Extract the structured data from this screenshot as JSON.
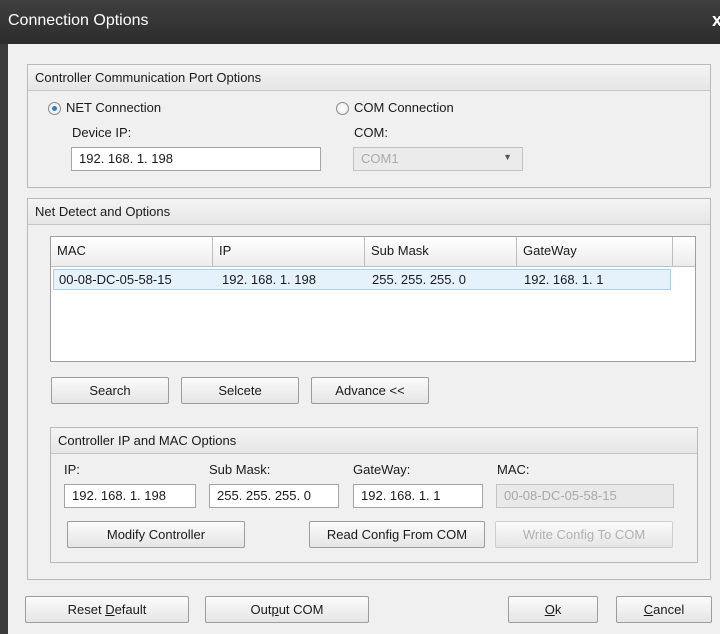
{
  "window": {
    "title": "Connection Options",
    "close_glyph": "x"
  },
  "port_options": {
    "header": "Controller Communication Port Options",
    "net": {
      "label": "NET Connection",
      "selected": true,
      "device_ip_label": "Device IP:",
      "device_ip_value": "192. 168. 1. 198"
    },
    "com": {
      "label": "COM Connection",
      "selected": false,
      "com_label": "COM:",
      "com_value": "COM1"
    }
  },
  "net_detect": {
    "header": "Net Detect and Options",
    "columns": [
      "MAC",
      "IP",
      "Sub Mask",
      "GateWay"
    ],
    "rows": [
      {
        "mac": "00-08-DC-05-58-15",
        "ip": "192. 168. 1. 198",
        "mask": "255. 255. 255. 0",
        "gateway": "192. 168. 1. 1"
      }
    ],
    "buttons": {
      "search": "Search",
      "selcete": "Selcete",
      "advance": "Advance <<"
    }
  },
  "ip_mac_options": {
    "header": "Controller IP and MAC Options",
    "ip_label": "IP:",
    "ip_value": "192. 168. 1. 198",
    "mask_label": "Sub Mask:",
    "mask_value": "255. 255. 255. 0",
    "gateway_label": "GateWay:",
    "gateway_value": "192. 168. 1. 1",
    "mac_label": "MAC:",
    "mac_value": "00-08-DC-05-58-15",
    "buttons": {
      "modify": "Modify Controller",
      "read_config": "Read Config From COM",
      "write_config": "Write Config To COM"
    }
  },
  "footer": {
    "reset_pre": "Reset ",
    "reset_key": "D",
    "reset_post": "efault",
    "output_pre": "Out",
    "output_key": "p",
    "output_post": "ut COM",
    "ok_key": "O",
    "ok_post": "k",
    "cancel_key": "C",
    "cancel_post": "ancel"
  }
}
